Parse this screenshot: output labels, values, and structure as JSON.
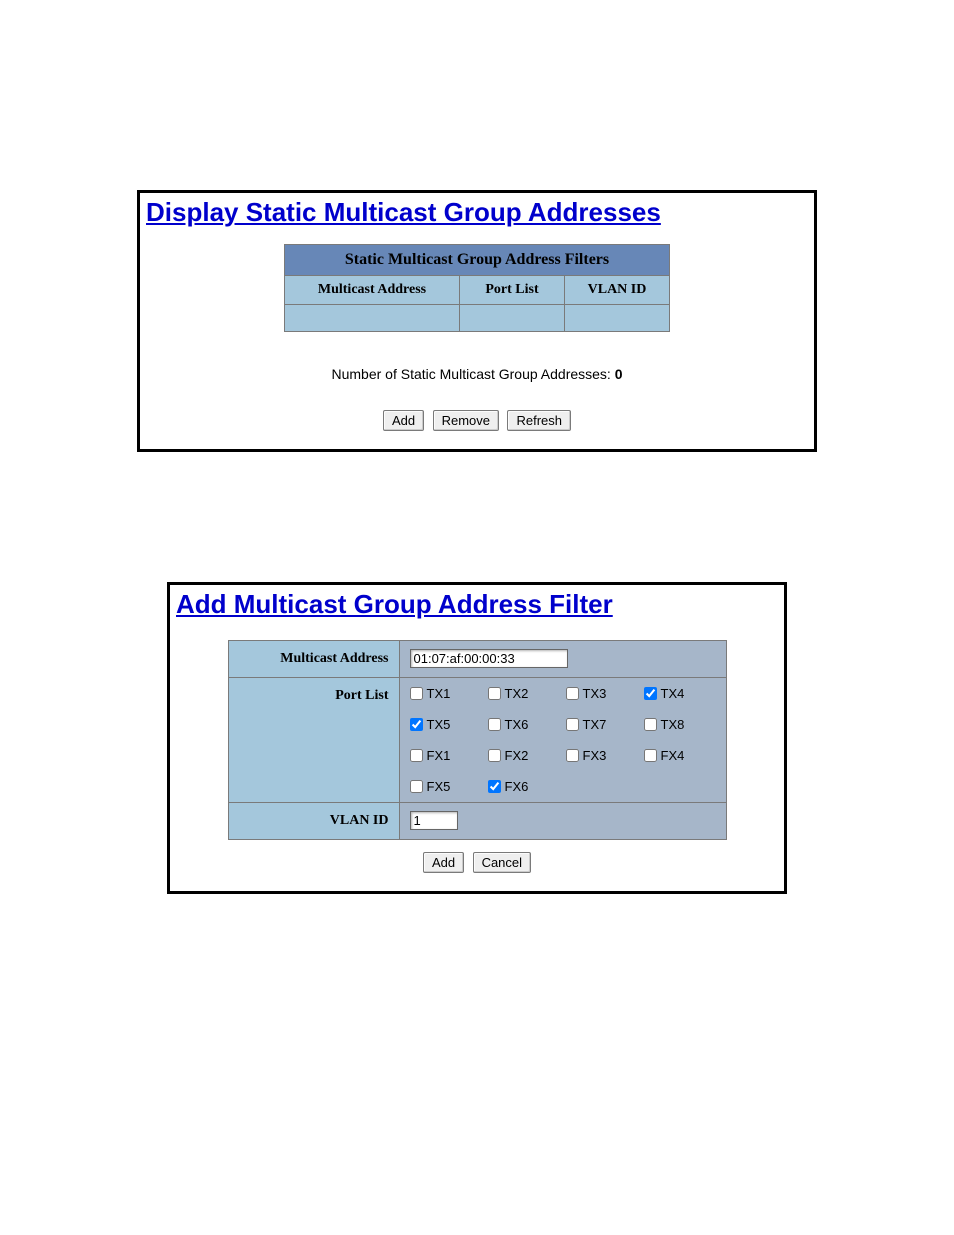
{
  "panel1": {
    "title": "Display Static Multicast Group Addresses",
    "tableHeader": "Static Multicast Group Address Filters",
    "columns": [
      "Multicast Address",
      "Port List",
      "VLAN ID"
    ],
    "countPrefix": "Number of Static Multicast Group Addresses: ",
    "countValue": "0",
    "buttons": {
      "add": "Add",
      "remove": "Remove",
      "refresh": "Refresh"
    }
  },
  "panel2": {
    "title": "Add Multicast Group Address Filter",
    "rows": {
      "multicastLabel": "Multicast Address",
      "multicastValue": "01:07:af:00:00:33",
      "portListLabel": "Port List",
      "vlanLabel": "VLAN ID",
      "vlanValue": "1"
    },
    "ports": [
      {
        "name": "TX1",
        "checked": false
      },
      {
        "name": "TX2",
        "checked": false
      },
      {
        "name": "TX3",
        "checked": false
      },
      {
        "name": "TX4",
        "checked": true
      },
      {
        "name": "TX5",
        "checked": true
      },
      {
        "name": "TX6",
        "checked": false
      },
      {
        "name": "TX7",
        "checked": false
      },
      {
        "name": "TX8",
        "checked": false
      },
      {
        "name": "FX1",
        "checked": false
      },
      {
        "name": "FX2",
        "checked": false
      },
      {
        "name": "FX3",
        "checked": false
      },
      {
        "name": "FX4",
        "checked": false
      },
      {
        "name": "FX5",
        "checked": false
      },
      {
        "name": "FX6",
        "checked": true
      }
    ],
    "buttons": {
      "add": "Add",
      "cancel": "Cancel"
    }
  }
}
